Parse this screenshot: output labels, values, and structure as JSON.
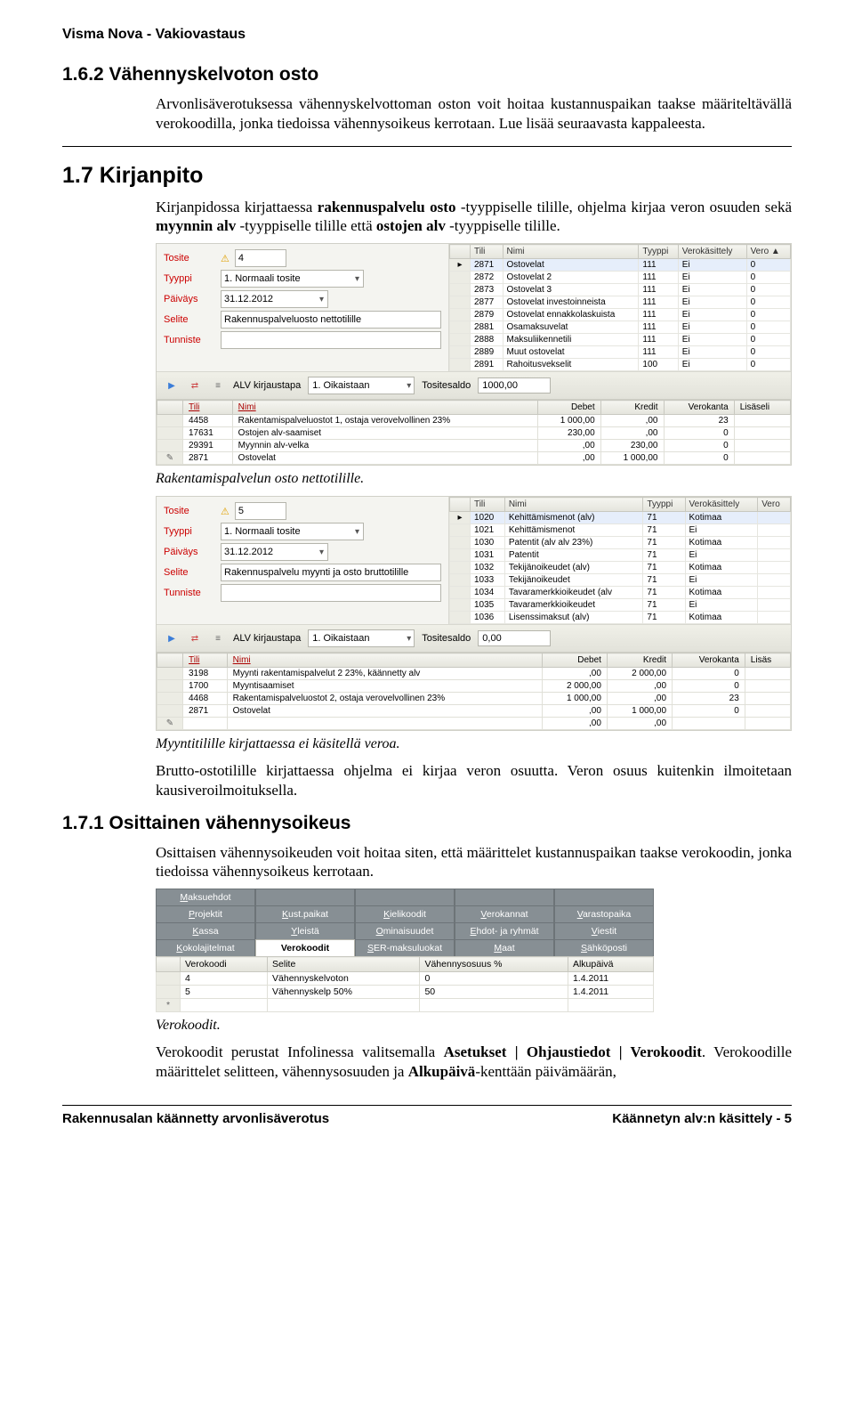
{
  "header": "Visma Nova - Vakiovastaus",
  "s162": {
    "title": "1.6.2   Vähennyskelvoton osto",
    "para": "Arvonlisäverotuksessa vähennyskelvottoman oston voit hoitaa kustannuspaikan taakse määriteltävällä verokoodilla, jonka tiedoissa vähennysoikeus kerrotaan. Lue lisää seuraavasta kappaleesta."
  },
  "s17": {
    "title": "1.7   Kirjanpito",
    "intro": "Kirjanpidossa kirjattaessa rakennuspalvelu osto -tyyppiselle tilille, ohjelma kirjaa veron osuuden sekä myynnin alv -tyyppiselle tilille että ostojen alv -tyyppiselle tilille.",
    "intro_bold": {
      "b1": "rakennuspalvelu osto",
      "b2": "myynnin alv",
      "b3": "ostojen alv"
    }
  },
  "shot1": {
    "form": {
      "tosite_label": "Tosite",
      "tosite_value": "4",
      "tyyppi_label": "Tyyppi",
      "tyyppi_value": "1. Normaali tosite",
      "paivays_label": "Päiväys",
      "paivays_value": "31.12.2012",
      "selite_label": "Selite",
      "selite_value": "Rakennuspalveluosto nettotilille",
      "tunniste_label": "Tunniste"
    },
    "right_headers": [
      "Tili",
      "Nimi",
      "Tyyppi",
      "Verokäsittely",
      "Vero ▲"
    ],
    "right_rows": [
      [
        "2871",
        "Ostovelat",
        "111",
        "Ei",
        "0"
      ],
      [
        "2872",
        "Ostovelat 2",
        "111",
        "Ei",
        "0"
      ],
      [
        "2873",
        "Ostovelat 3",
        "111",
        "Ei",
        "0"
      ],
      [
        "2877",
        "Ostovelat investoinneista",
        "111",
        "Ei",
        "0"
      ],
      [
        "2879",
        "Ostovelat ennakkolaskuista",
        "111",
        "Ei",
        "0"
      ],
      [
        "2881",
        "Osamaksuvelat",
        "111",
        "Ei",
        "0"
      ],
      [
        "2888",
        "Maksuliikennetili",
        "111",
        "Ei",
        "0"
      ],
      [
        "2889",
        "Muut ostovelat",
        "111",
        "Ei",
        "0"
      ],
      [
        "2891",
        "Rahoitusvekselit",
        "100",
        "Ei",
        "0"
      ]
    ],
    "toolbar": {
      "alv_label": "ALV kirjaustapa",
      "alv_value": "1. Oikaistaan",
      "saldo_label": "Tositesaldo",
      "saldo_value": "1000,00"
    },
    "entry_headers": [
      "Tili",
      "Nimi",
      "Debet",
      "Kredit",
      "Verokanta",
      "Lisäseli"
    ],
    "entry_rows": [
      [
        "4458",
        "Rakentamispalveluostot 1, ostaja verovelvollinen 23%",
        "1 000,00",
        ",00",
        "23",
        ""
      ],
      [
        "17631",
        "Ostojen alv-saamiset",
        "230,00",
        ",00",
        "0",
        ""
      ],
      [
        "29391",
        "Myynnin alv-velka",
        ",00",
        "230,00",
        "0",
        ""
      ],
      [
        "2871",
        "Ostovelat",
        ",00",
        "1 000,00",
        "0",
        ""
      ]
    ],
    "caption": "Rakentamispalvelun osto nettotilille."
  },
  "shot2": {
    "form": {
      "tosite_label": "Tosite",
      "tosite_value": "5",
      "tyyppi_label": "Tyyppi",
      "tyyppi_value": "1. Normaali tosite",
      "paivays_label": "Päiväys",
      "paivays_value": "31.12.2012",
      "selite_label": "Selite",
      "selite_value": "Rakennuspalvelu myynti ja osto bruttotilille",
      "tunniste_label": "Tunniste"
    },
    "right_headers": [
      "Tili",
      "Nimi",
      "Tyyppi",
      "Verokäsittely",
      "Vero"
    ],
    "right_rows": [
      [
        "1020",
        "Kehittämismenot (alv)",
        "71",
        "Kotimaa",
        ""
      ],
      [
        "1021",
        "Kehittämismenot",
        "71",
        "Ei",
        ""
      ],
      [
        "1030",
        "Patentit (alv alv 23%)",
        "71",
        "Kotimaa",
        ""
      ],
      [
        "1031",
        "Patentit",
        "71",
        "Ei",
        ""
      ],
      [
        "1032",
        "Tekijänoikeudet (alv)",
        "71",
        "Kotimaa",
        ""
      ],
      [
        "1033",
        "Tekijänoikeudet",
        "71",
        "Ei",
        ""
      ],
      [
        "1034",
        "Tavaramerkkioikeudet (alv",
        "71",
        "Kotimaa",
        ""
      ],
      [
        "1035",
        "Tavaramerkkioikeudet",
        "71",
        "Ei",
        ""
      ],
      [
        "1036",
        "Lisenssimaksut (alv)",
        "71",
        "Kotimaa",
        ""
      ]
    ],
    "toolbar": {
      "alv_label": "ALV kirjaustapa",
      "alv_value": "1. Oikaistaan",
      "saldo_label": "Tositesaldo",
      "saldo_value": "0,00"
    },
    "entry_headers": [
      "Tili",
      "Nimi",
      "Debet",
      "Kredit",
      "Verokanta",
      "Lisäs"
    ],
    "entry_rows": [
      [
        "3198",
        "Myynti rakentamispalvelut 2 23%, käännetty alv",
        ",00",
        "2 000,00",
        "0",
        ""
      ],
      [
        "1700",
        "Myyntisaamiset",
        "2 000,00",
        ",00",
        "0",
        ""
      ],
      [
        "4468",
        "Rakentamispalveluostot 2, ostaja verovelvollinen 23%",
        "1 000,00",
        ",00",
        "23",
        ""
      ],
      [
        "2871",
        "Ostovelat",
        ",00",
        "1 000,00",
        "0",
        ""
      ],
      [
        "",
        "",
        ",00",
        ",00",
        "",
        ""
      ]
    ],
    "caption": "Myyntitilille kirjattaessa ei käsitellä veroa.",
    "after1": "Brutto-ostotilille kirjattaessa ohjelma ei kirjaa veron osuutta. Veron osuus kuitenkin ilmoitetaan kausiveroilmoituksella."
  },
  "s171": {
    "title": "1.7.1   Osittainen vähennysoikeus",
    "para": "Osittaisen vähennysoikeuden voit hoitaa siten, että määrittelet kustannuspaikan taakse verokoodin, jonka tiedoissa vähennysoikeus kerrotaan."
  },
  "vshot": {
    "tab_rows": [
      [
        "Maksuehdot",
        "",
        "",
        "",
        ""
      ],
      [
        "Projektit",
        "Kust.paikat",
        "Kielikoodit",
        "Verokannat",
        "Varastopaika"
      ],
      [
        "Kassa",
        "Yleistä",
        "Ominaisuudet",
        "Ehdot- ja ryhmät",
        "Viestit"
      ],
      [
        "Kokolajitelmat",
        "Verokoodit",
        "SER-maksuluokat",
        "Maat",
        "Sähköposti"
      ]
    ],
    "active_tab": "Verokoodit",
    "headers": [
      "Verokoodi",
      "Selite",
      "Vähennysosuus %",
      "Alkupäivä"
    ],
    "rows": [
      [
        "4",
        "Vähennyskelvoton",
        "0",
        "1.4.2011"
      ],
      [
        "5",
        "Vähennyskelp 50%",
        "50",
        "1.4.2011"
      ]
    ],
    "caption": "Verokoodit.",
    "after": "Verokoodit perustat Infolinessa valitsemalla Asetukset | Ohjaustiedot | Verokoodit. Verokoodille määrittelet selitteen, vähennysosuuden ja Alkupäivä-kenttään päivämäärän,",
    "after_bold": {
      "b1": "Asetukset | Ohjaustiedot | Verokoodit",
      "b2": "Alkupäivä"
    }
  },
  "footer": {
    "left": "Rakennusalan käännetty arvonlisäverotus",
    "right": "Käännetyn alv:n käsittely - 5"
  }
}
